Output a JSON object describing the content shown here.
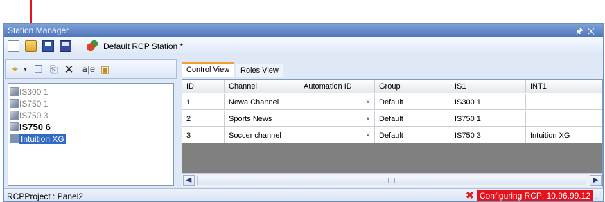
{
  "window": {
    "title": "Station Manager",
    "controls": "1 ✕"
  },
  "toolbar": {
    "station_name": "Default RCP Station *"
  },
  "left_toolbar": {
    "rename_glyph": "a|e"
  },
  "stations": [
    {
      "label": "IS300 1",
      "bold": false,
      "selected": false
    },
    {
      "label": "IS750 1",
      "bold": false,
      "selected": false
    },
    {
      "label": "IS750 3",
      "bold": false,
      "selected": false
    },
    {
      "label": "IS750 6",
      "bold": true,
      "selected": false
    },
    {
      "label": "Intuition XG",
      "bold": false,
      "selected": true
    }
  ],
  "tabs": [
    {
      "label": "Control View",
      "active": true
    },
    {
      "label": "Roles View",
      "active": false
    }
  ],
  "grid": {
    "columns": [
      "ID",
      "Channel",
      "Automation ID",
      "Group",
      "IS1",
      "INT1"
    ],
    "rows": [
      [
        "1",
        "Newa Channel",
        "",
        "Default",
        "IS300 1",
        ""
      ],
      [
        "2",
        "Sports News",
        "",
        "Default",
        "IS750 1",
        ""
      ],
      [
        "3",
        "Soccer channel",
        "",
        "Default",
        "IS750 3",
        "Intuition XG"
      ]
    ]
  },
  "statusbar": {
    "left": "RCPProject : Panel2",
    "right": "Configuring RCP: 10.96.99.12"
  },
  "colors": {
    "annotation_arrow": "#e8101a",
    "selection": "#3169c6",
    "status_alert": "#e8101a"
  }
}
